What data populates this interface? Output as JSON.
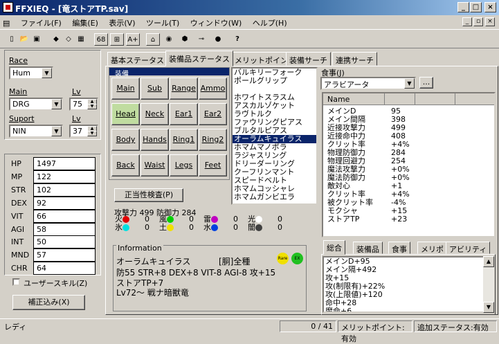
{
  "window": {
    "title": "FFXIEQ - [竜ストアTP.sav]",
    "min": "_",
    "max": "□",
    "close": "×"
  },
  "menu": [
    "ファイル(F)",
    "編集(E)",
    "表示(V)",
    "ツール(T)",
    "ウィンドウ(W)",
    "ヘルプ(H)"
  ],
  "toolbar": {
    "b1": "68",
    "b2": "A+",
    "help": "?"
  },
  "left": {
    "race_label": "Race",
    "race": "Hum",
    "main_label": "Main",
    "main": "DRG",
    "lv_label": "Lv",
    "main_lv": "75",
    "sub_label": "Suport",
    "sub": "NIN",
    "sub_lv_label": "Lv",
    "sub_lv": "37",
    "stats": [
      {
        "k": "HP",
        "v": "1497"
      },
      {
        "k": "MP",
        "v": "122"
      },
      {
        "k": "STR",
        "v": "102"
      },
      {
        "k": "DEX",
        "v": "92"
      },
      {
        "k": "VIT",
        "v": "66"
      },
      {
        "k": "AGI",
        "v": "58"
      },
      {
        "k": "INT",
        "v": "50"
      },
      {
        "k": "MND",
        "v": "57"
      },
      {
        "k": "CHR",
        "v": "64"
      }
    ],
    "user_skill": "ユーザースキル(Z)",
    "correct_btn": "補正込み(X)"
  },
  "tabs": [
    "基本ステータス",
    "装備品ステータス",
    "メリットポイント",
    "装備サーチ",
    "連携サーチ"
  ],
  "equip": {
    "group": "装備",
    "slots": [
      "Main",
      "Sub",
      "Range",
      "Ammo",
      "Head",
      "Neck",
      "Ear1",
      "Ear2",
      "Body",
      "Hands",
      "Ring1",
      "Ring2",
      "Back",
      "Waist",
      "Legs",
      "Feet"
    ],
    "check_btn": "正当性検査(P)",
    "atk_def": "攻撃力 499 防御力 284",
    "elements": [
      {
        "k": "火",
        "v": "0",
        "c": "#e00000"
      },
      {
        "k": "風",
        "v": "0",
        "c": "#00d000"
      },
      {
        "k": "雷",
        "v": "0",
        "c": "#c000c0"
      },
      {
        "k": "光",
        "v": "0",
        "c": "#ffffff"
      },
      {
        "k": "氷",
        "v": "0",
        "c": "#00e0e0"
      },
      {
        "k": "土",
        "v": "0",
        "c": "#f0e000"
      },
      {
        "k": "水",
        "v": "0",
        "c": "#0040e0"
      },
      {
        "k": "闇",
        "v": "0",
        "c": "#404040"
      }
    ]
  },
  "items": [
    "バルキリーフォーク",
    "ポールグリップ",
    "",
    "ホワイトスラスム",
    "アスカルゾケット",
    "ラヴトルク",
    "ファウリングピアス",
    "ブルタルピアス",
    "オーラムキュイラス",
    "ホマムマノポラ",
    "ラジャスリング",
    "ドリーダーリング",
    "クーフリンマント",
    "スピードベルト",
    "ホマムコッシャレ",
    "ホマムガンビエラ"
  ],
  "info": {
    "label": "Information",
    "name": "オーラムキュイラス",
    "jobs": "[胴]全種",
    "line1": "防55 STR+8 DEX+8 VIT-8 AGI-8 攻+15",
    "line2": "ストアTP+7",
    "line3": "Lv72～ 戦ナ暗獣竜",
    "rare": "Rare",
    "ex": "EX"
  },
  "food": {
    "label": "食事(J)",
    "value": "アラビアータ",
    "btn": "..."
  },
  "grid": {
    "header": "Name",
    "rows": [
      {
        "k": "メインD",
        "v": "95"
      },
      {
        "k": "メイン間隔",
        "v": "398"
      },
      {
        "k": "近接攻撃力",
        "v": "499"
      },
      {
        "k": "近接命中力",
        "v": "408"
      },
      {
        "k": "クリット率",
        "v": "+4%"
      },
      {
        "k": "物理防御力",
        "v": "284"
      },
      {
        "k": "物理回避力",
        "v": "254"
      },
      {
        "k": "魔法攻撃力",
        "v": "+0%"
      },
      {
        "k": "魔法防御力",
        "v": "+0%"
      },
      {
        "k": "敵対心",
        "v": "+1"
      },
      {
        "k": "クリット率",
        "v": "+4%"
      },
      {
        "k": "被クリット率",
        "v": "-4%"
      },
      {
        "k": "モクシャ",
        "v": "+15"
      },
      {
        "k": "ストアTP",
        "v": "+23"
      }
    ]
  },
  "subtabs": [
    "総合",
    "装備品",
    "食事",
    "メリポ",
    "アビリティ"
  ],
  "summary": [
    "メインD+95",
    "メイン隔+492",
    "攻+15",
    "攻(制限有)+22%",
    "攻(上限値)+120",
    "命中+28",
    "魔命+6"
  ],
  "status": {
    "ready": "レディ",
    "count": "0 / 41",
    "merit": "メリットポイント:有効",
    "extra": "追加ステータス:有効"
  }
}
